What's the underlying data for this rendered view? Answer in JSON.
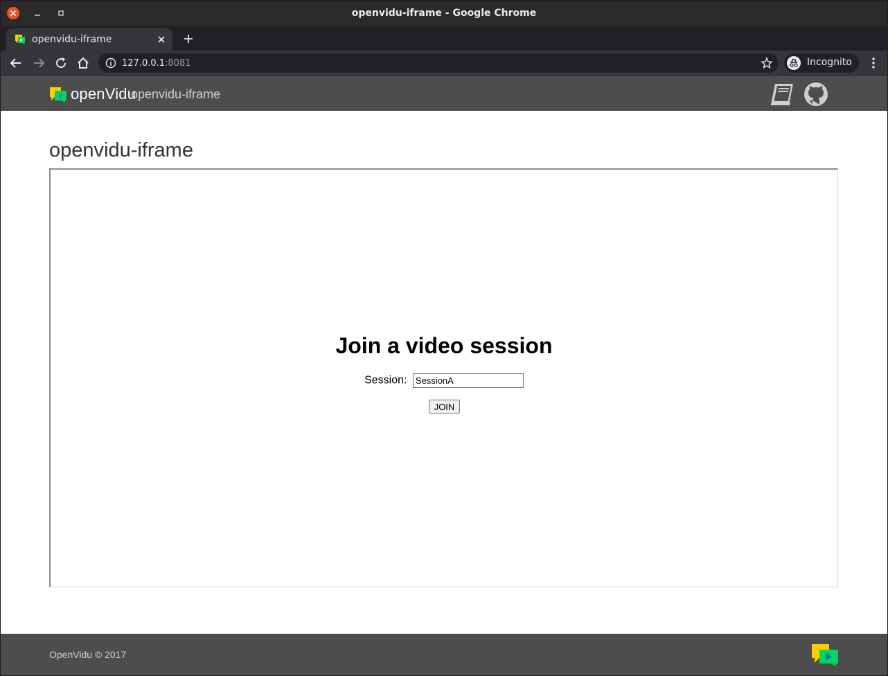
{
  "window": {
    "title": "openvidu-iframe - Google Chrome"
  },
  "tab": {
    "title": "openvidu-iframe"
  },
  "omnibox": {
    "url_host": "127.0.0.1",
    "url_port": ":8081"
  },
  "incognito": {
    "label": "Incognito"
  },
  "navbar": {
    "brand_logo_text": "openVidu",
    "app_name": "openvidu-iframe"
  },
  "main": {
    "page_title": "openvidu-iframe",
    "join_title": "Join a video session",
    "session_label": "Session:",
    "session_value": "SessionA",
    "join_button": "JOIN"
  },
  "footer": {
    "copyright": "OpenVidu © 2017"
  },
  "colors": {
    "brand_yellow": "#ffcc00",
    "brand_green": "#06d362",
    "brand_teal": "#0088aa",
    "ubuntu_close": "#e95420",
    "navbar_bg": "#4d4d4d"
  },
  "icons": {
    "window_close": "close-icon",
    "window_minimize": "minimize-icon",
    "window_maximize": "maximize-icon",
    "tab_favicon": "openvidu-favicon",
    "tab_close": "close-icon",
    "new_tab": "plus-icon",
    "back": "arrow-left-icon",
    "forward": "arrow-right-icon",
    "reload": "reload-icon",
    "home": "home-icon",
    "site_info": "info-icon",
    "bookmark": "star-icon",
    "incognito": "incognito-icon",
    "menu": "more-vert-icon",
    "docs": "book-icon",
    "github": "github-icon"
  }
}
